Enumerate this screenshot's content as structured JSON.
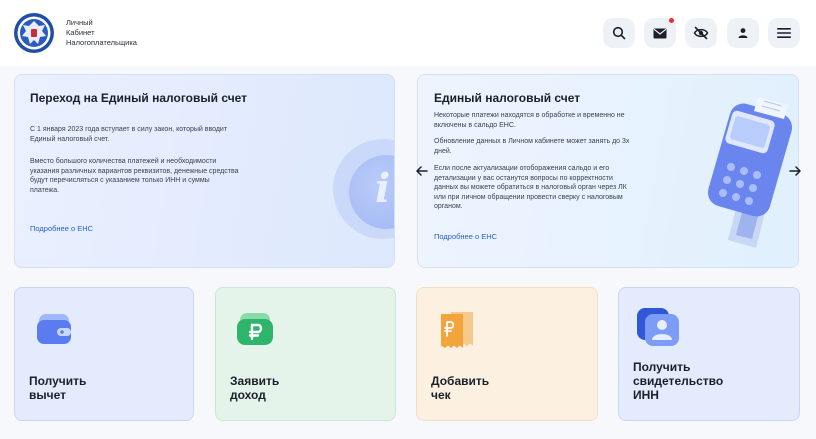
{
  "header": {
    "brand_lines": [
      "Личный",
      "Кабинет",
      "Налогоплательщика"
    ],
    "icons": [
      "search-icon",
      "mail-icon",
      "eye-off-icon",
      "user-icon",
      "menu-icon"
    ],
    "notification_dot_color": "#ef2e2e"
  },
  "banners": [
    {
      "title": "Переход на Единый налоговый счет",
      "paragraphs": [
        "С 1 января 2023 года вступает в силу закон, который вводит Единый налоговый счет.",
        "Вместо большого количества платежей и необходимости указания различных вариантов реквизитов, денежные средства будут перечисляться с указанием только ИНН и суммы платежа."
      ],
      "link": "Подробнее о ЕНС",
      "illustration": "info-icon"
    },
    {
      "title": "Единый налоговый счет",
      "paragraphs": [
        "Некоторые платежи находятся в обработке и временно не включены в сальдо ЕНС.",
        "Обновление данных в Личном кабинете может занять до 3х дней.",
        "Если после актуализации отоборажения сальдо и его детализации у вас останутся вопросы по корректности данных вы можете обратиться в налоговый орган через ЛК или при личном обращении провести сверку с налоговым органом."
      ],
      "link": "Подробнее о ЕНС",
      "illustration": "payment-terminal-icon"
    }
  ],
  "cards": [
    {
      "label_lines": [
        "Получить",
        "вычет"
      ],
      "icon": "wallet-icon",
      "color": "#e3ebfd"
    },
    {
      "label_lines": [
        "Заявить",
        "доход"
      ],
      "icon": "ruble-wallet-icon",
      "color": "#e4f4ea"
    },
    {
      "label_lines": [
        "Добавить",
        "чек"
      ],
      "icon": "receipt-icon",
      "color": "#fcf1e1"
    },
    {
      "label_lines": [
        "Получить",
        "свидетельство",
        "ИНН"
      ],
      "icon": "id-card-icon",
      "color": "#e3ebfd"
    }
  ],
  "colors": {
    "link": "#2460d6",
    "banner_bg": "#eaf0fe",
    "accent_blue": "#5b7cf0",
    "accent_green": "#2fb56b",
    "accent_orange": "#f3a53c"
  }
}
